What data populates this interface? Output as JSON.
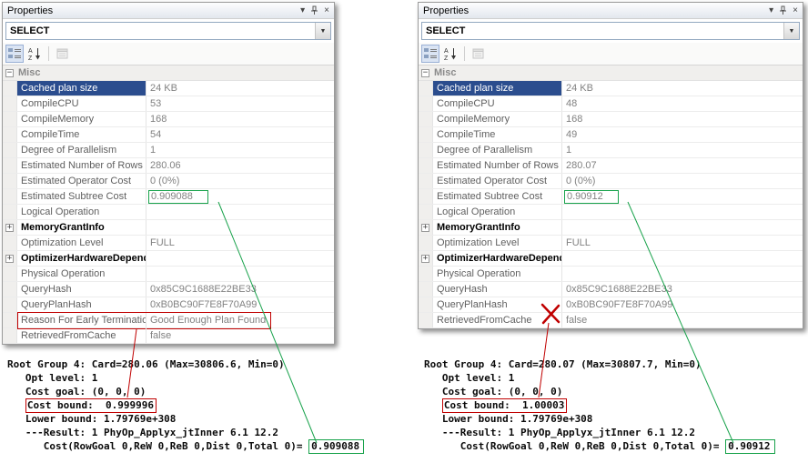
{
  "colors": {
    "highlight_green": "#18a24b",
    "highlight_red": "#c00000",
    "selection_blue": "#2b4d8e"
  },
  "icons": {
    "window_menu": "▾",
    "close": "×",
    "dropdown_arrow": "▼",
    "expand": "+",
    "collapse": "−"
  },
  "panels": [
    {
      "title": "Properties",
      "selector": "SELECT",
      "category": "Misc",
      "rows": [
        {
          "name": "Cached plan size",
          "value": "24 KB",
          "selected": true
        },
        {
          "name": "CompileCPU",
          "value": "53"
        },
        {
          "name": "CompileMemory",
          "value": "168"
        },
        {
          "name": "CompileTime",
          "value": "54"
        },
        {
          "name": "Degree of Parallelism",
          "value": "1"
        },
        {
          "name": "Estimated Number of Rows",
          "value": "280.06"
        },
        {
          "name": "Estimated Operator Cost",
          "value": "0 (0%)"
        },
        {
          "name": "Estimated Subtree Cost",
          "value": "0.909088",
          "highlight": "green"
        },
        {
          "name": "Logical Operation",
          "value": ""
        },
        {
          "name": "MemoryGrantInfo",
          "value": "",
          "expandable": true
        },
        {
          "name": "Optimization Level",
          "value": "FULL"
        },
        {
          "name": "OptimizerHardwareDependen",
          "value": "",
          "expandable": true
        },
        {
          "name": "Physical Operation",
          "value": ""
        },
        {
          "name": "QueryHash",
          "value": "0x85C9C1688E22BE33"
        },
        {
          "name": "QueryPlanHash",
          "value": "0xB0BC90F7E8F70A99"
        },
        {
          "name": "Reason For Early Termination",
          "value": "Good Enough Plan Found",
          "highlight": "red"
        },
        {
          "name": "RetrievedFromCache",
          "value": "false"
        }
      ],
      "memo": [
        [
          {
            "t": "Root Group 4: Card=280.06 (Max=30806.6, Min=0)"
          }
        ],
        [
          {
            "t": "   Opt level: 1"
          }
        ],
        [
          {
            "t": "   Cost goal: (0, 0, 0)"
          }
        ],
        [
          {
            "t": "   "
          },
          {
            "t": "Cost bound:  0.999996",
            "box": "red"
          }
        ],
        [
          {
            "t": "   Lower bound: 1.79769e+308"
          }
        ],
        [
          {
            "t": "   ---Result: 1 PhyOp_Applyx_jtInner 6.1 12.2"
          }
        ],
        [
          {
            "t": "      Cost(RowGoal 0,ReW 0,ReB 0,Dist 0,Total 0)= "
          },
          {
            "t": "0.909088",
            "box": "green"
          }
        ]
      ]
    },
    {
      "title": "Properties",
      "selector": "SELECT",
      "category": "Misc",
      "rows": [
        {
          "name": "Cached plan size",
          "value": "24 KB",
          "selected": true
        },
        {
          "name": "CompileCPU",
          "value": "48"
        },
        {
          "name": "CompileMemory",
          "value": "168"
        },
        {
          "name": "CompileTime",
          "value": "49"
        },
        {
          "name": "Degree of Parallelism",
          "value": "1"
        },
        {
          "name": "Estimated Number of Rows",
          "value": "280.07"
        },
        {
          "name": "Estimated Operator Cost",
          "value": "0 (0%)"
        },
        {
          "name": "Estimated Subtree Cost",
          "value": "0.90912",
          "highlight": "green"
        },
        {
          "name": "Logical Operation",
          "value": ""
        },
        {
          "name": "MemoryGrantInfo",
          "value": "",
          "expandable": true
        },
        {
          "name": "Optimization Level",
          "value": "FULL"
        },
        {
          "name": "OptimizerHardwareDependen",
          "value": "",
          "expandable": true
        },
        {
          "name": "Physical Operation",
          "value": ""
        },
        {
          "name": "QueryHash",
          "value": "0x85C9C1688E22BE33"
        },
        {
          "name": "QueryPlanHash",
          "value": "0xB0BC90F7E8F70A99"
        },
        {
          "name": "RetrievedFromCache",
          "value": "false"
        }
      ],
      "memo": [
        [
          {
            "t": "Root Group 4: Card=280.07 (Max=30807.7, Min=0)"
          }
        ],
        [
          {
            "t": "   Opt level: 1"
          }
        ],
        [
          {
            "t": "   Cost goal: (0, 0, 0)"
          }
        ],
        [
          {
            "t": "   "
          },
          {
            "t": "Cost bound:  1.00003",
            "box": "red"
          }
        ],
        [
          {
            "t": "   Lower bound: 1.79769e+308"
          }
        ],
        [
          {
            "t": "   ---Result: 1 PhyOp_Applyx_jtInner 6.1 12.2"
          }
        ],
        [
          {
            "t": "      Cost(RowGoal 0,ReW 0,ReB 0,Dist 0,Total 0)= "
          },
          {
            "t": "0.90912",
            "box": "green"
          }
        ]
      ]
    }
  ]
}
